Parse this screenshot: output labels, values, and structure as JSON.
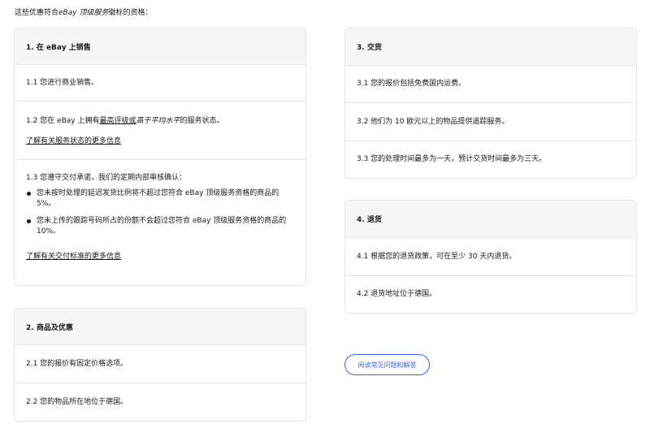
{
  "intro": {
    "prefix": "这些优惠符合",
    "badge": "eBay 顶级服务",
    "suffix": "徽标的资格："
  },
  "card1": {
    "title": "1. 在 eBay 上销售",
    "row1": "1.1 您进行商业销售。",
    "row2": {
      "prefix": "1.2 您在 eBay 上拥有",
      "link1": "最高评级或",
      "middle": "高于平均水平",
      "suffix": "的服务状态。",
      "more_link": "了解有关服务状态的更多信息"
    },
    "row3": {
      "text": "1.3 您遵守交付承诺，我们的定期内部审核确认：",
      "bullets": [
        "您未按时处理的延迟发货比例将不超过您符合 eBay 顶级服务资格的商品的 5%。",
        "您未上传的跟踪号码所占的份额不会超过您符合 eBay 顶级服务资格的商品的 10%。"
      ],
      "more_link": "了解有关交付标准的更多信息"
    }
  },
  "card2": {
    "title": "2. 商品及优惠",
    "row1": "2.1 您的报价有固定价格选项。",
    "row2": "2.2 您的物品所在地位于德国。"
  },
  "card3": {
    "title": "3. 交货",
    "row1": "3.1 您的报价包括免费国内运费。",
    "row2": "3.2 他们为 10 欧元以上的物品提供追踪服务。",
    "row3": "3.3 您的处理时间最多为一天，预计交货时间最多为三天。"
  },
  "card4": {
    "title": "4. 退货",
    "row1": "4.1 根据您的退货政策，可在至少 30 天内退货。",
    "row2": "4.2 退货地址位于德国。"
  },
  "faq_button": "阅读常见问题和解答",
  "colors": {
    "accent": "#3665f3",
    "header_bg": "#f7f7f7",
    "border": "#e5e5e5"
  }
}
